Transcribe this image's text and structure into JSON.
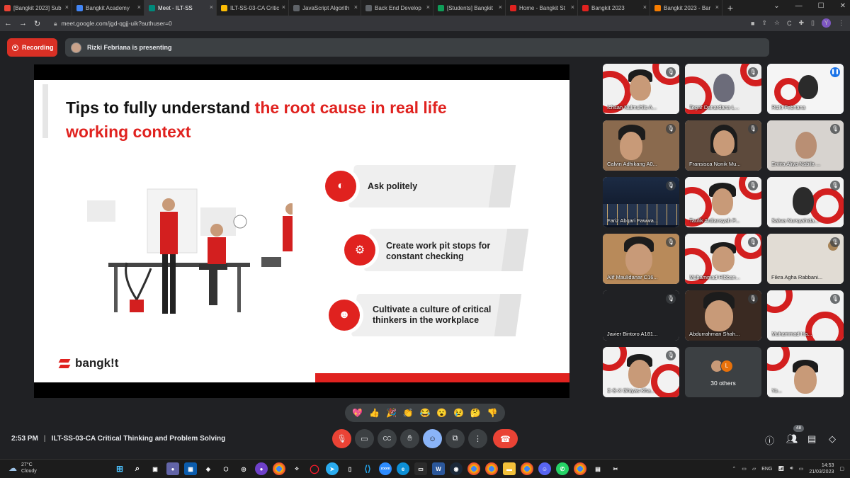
{
  "browser": {
    "tabs": [
      {
        "label": "[Bangkit 2023] Sub",
        "color": "#ea4335"
      },
      {
        "label": "Bangkit Academy",
        "color": "#4285f4"
      },
      {
        "label": "Meet - ILT-SS",
        "color": "#00897b",
        "active": true
      },
      {
        "label": "ILT-SS-03-CA Critic",
        "color": "#fbbc04"
      },
      {
        "label": "JavaScript Algorith",
        "color": "#5f6368"
      },
      {
        "label": "Back End Develop",
        "color": "#5f6368"
      },
      {
        "label": "[Students] Bangkit",
        "color": "#0f9d58"
      },
      {
        "label": "Home - Bangkit St",
        "color": "#e0221f"
      },
      {
        "label": "Bangkit 2023",
        "color": "#e0221f"
      },
      {
        "label": "Bangkit 2023 - Bar",
        "color": "#f57c00"
      }
    ],
    "url": "meet.google.com/jgd-qgjj-uik?authuser=0",
    "profile_initial": "Y"
  },
  "meet": {
    "recording_label": "Recording",
    "presenting_label": "Rizki Febriana is presenting",
    "meeting_time": "2:53 PM",
    "meeting_title": "ILT-SS-03-CA Critical Thinking and Problem Solving",
    "participant_count": "48",
    "others_label": "30 others",
    "others_initial": "L"
  },
  "slide": {
    "title_part1": "Tips to fully understand ",
    "title_part2": "the root cause in real life working context",
    "tips": [
      {
        "line1": "Ask politely",
        "line2": ""
      },
      {
        "line1": "Create work pit stops for",
        "line2": "constant checking"
      },
      {
        "line1": "Cultivate a culture of critical",
        "line2": "thinkers in the workplace"
      }
    ],
    "brand": "bangk!t"
  },
  "participants": [
    {
      "name": "Ichsan Nulmuhlis A..."
    },
    {
      "name": "Tegar Danardana L..."
    },
    {
      "name": "Rizki Febriana",
      "speaking": true
    },
    {
      "name": "Calvin Adhikang A0..."
    },
    {
      "name": "Fransisca Nonik Mu..."
    },
    {
      "name": "Ervira Aliya Nabila ..."
    },
    {
      "name": "Fariz Abqari Fawwa..."
    },
    {
      "name": "Taufik Ardiansyah P..."
    },
    {
      "name": "Salwa Nursyahida..."
    },
    {
      "name": "Alif Maulidanar C16..."
    },
    {
      "name": "Muhammad Hibban..."
    },
    {
      "name": "Fikra Agha Rabbani..."
    },
    {
      "name": "Javier Bintoro A181..."
    },
    {
      "name": "Abdurrahman Shah..."
    },
    {
      "name": "Muhammad Ha..."
    },
    {
      "name": "C-S-X Ghiyas Kha..."
    },
    {
      "name": "Yo..."
    }
  ],
  "reactions": [
    "💖",
    "👍",
    "🎉",
    "👏",
    "😂",
    "😮",
    "😢",
    "🤔",
    "👎"
  ],
  "taskbar": {
    "temperature": "27°C",
    "weather": "Cloudy",
    "language": "ENG",
    "time": "14:53",
    "date": "21/03/2023"
  }
}
